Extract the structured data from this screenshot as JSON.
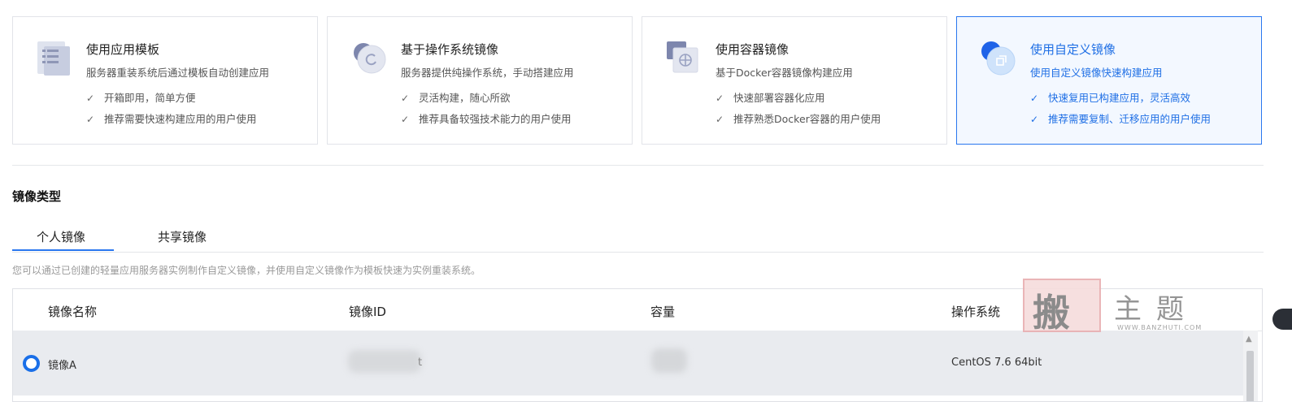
{
  "cards": [
    {
      "title": "使用应用模板",
      "desc": "服务器重装系统后通过模板自动创建应用",
      "features": [
        "开箱即用，简单方便",
        "推荐需要快速构建应用的用户使用"
      ],
      "icon": "app-template-icon",
      "selected": false
    },
    {
      "title": "基于操作系统镜像",
      "desc": "服务器提供纯操作系统，手动搭建应用",
      "features": [
        "灵活构建，随心所欲",
        "推荐具备较强技术能力的用户使用"
      ],
      "icon": "os-image-icon",
      "selected": false
    },
    {
      "title": "使用容器镜像",
      "desc": "基于Docker容器镜像构建应用",
      "features": [
        "快速部署容器化应用",
        "推荐熟悉Docker容器的用户使用"
      ],
      "icon": "container-image-icon",
      "selected": false
    },
    {
      "title": "使用自定义镜像",
      "desc": "使用自定义镜像快速构建应用",
      "features": [
        "快速复用已构建应用，灵活高效",
        "推荐需要复制、迁移应用的用户使用"
      ],
      "icon": "custom-image-icon",
      "selected": true
    }
  ],
  "check_glyph": "✓",
  "section_title": "镜像类型",
  "tabs": [
    {
      "label": "个人镜像",
      "active": true
    },
    {
      "label": "共享镜像",
      "active": false
    }
  ],
  "hint": "您可以通过已创建的轻量应用服务器实例制作自定义镜像，并使用自定义镜像作为模板快速为实例重装系统。",
  "table": {
    "headers": [
      "镜像名称",
      "镜像ID",
      "容量",
      "操作系统"
    ],
    "rows": [
      {
        "name": "镜像A",
        "id_suffix": "t",
        "os": "CentOS 7.6 64bit",
        "selected": true
      }
    ]
  },
  "watermark": {
    "seal": "搬",
    "text": "主题",
    "url": "WWW.BANZHUTI.COM"
  },
  "colors": {
    "accent": "#2a77ef",
    "selected_bg": "#f3f8ff",
    "row_bg": "#e9ebef"
  }
}
